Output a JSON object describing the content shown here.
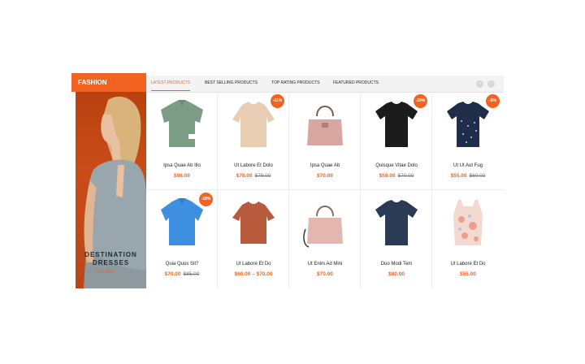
{
  "category": {
    "title": "FASHION",
    "banner_title_line1": "DESTINATION",
    "banner_title_line2": "DRESSES",
    "banner_link": "> See More"
  },
  "tabs": [
    {
      "label": "Latest Products",
      "active": true
    },
    {
      "label": "Best Selling Products",
      "active": false
    },
    {
      "label": "Top Rating Products",
      "active": false
    },
    {
      "label": "Featured Products",
      "active": false
    }
  ],
  "nav": {
    "prev": "‹",
    "next": "›"
  },
  "colors": {
    "accent": "#f26322",
    "tabbar": "#f3f3f3"
  },
  "products": [
    {
      "name": "Ipsa Quae Ab Illo",
      "price": "$98.00",
      "old_price": "",
      "badge": "",
      "image": "green-shirt-icon"
    },
    {
      "name": "Ut Labore Et Dolo",
      "price": "$70.00",
      "old_price": "$79.00",
      "badge": "-11%",
      "image": "beige-top-icon"
    },
    {
      "name": "Ipsa Quae Ab",
      "price": "$70.00",
      "old_price": "",
      "badge": "",
      "image": "pink-handbag-icon"
    },
    {
      "name": "Quisque Vitae Dolo",
      "price": "$50.00",
      "old_price": "$70.00",
      "badge": "-29%",
      "image": "black-tshirt-icon"
    },
    {
      "name": "Ut Ut Aut Fug",
      "price": "$55.00",
      "old_price": "$60.00",
      "badge": "-8%",
      "image": "navy-top-icon"
    },
    {
      "name": "Quia Quos Sit?",
      "price": "$70.00",
      "old_price": "$85.00",
      "badge": "-18%",
      "image": "blue-shirt-icon"
    },
    {
      "name": "Ut Labore Et Do",
      "price": "$60.00 – $70.00",
      "old_price": "",
      "badge": "",
      "image": "rust-top-icon"
    },
    {
      "name": "Ut Enim Ad Mini",
      "price": "$70.00",
      "old_price": "",
      "badge": "",
      "image": "pink-bag-icon"
    },
    {
      "name": "Duo Modi Tem",
      "price": "$80.00",
      "old_price": "",
      "badge": "",
      "image": "navy-tshirt-icon"
    },
    {
      "name": "Ut Labore Et Do",
      "price": "$55.00",
      "old_price": "",
      "badge": "",
      "image": "floral-top-icon"
    }
  ]
}
